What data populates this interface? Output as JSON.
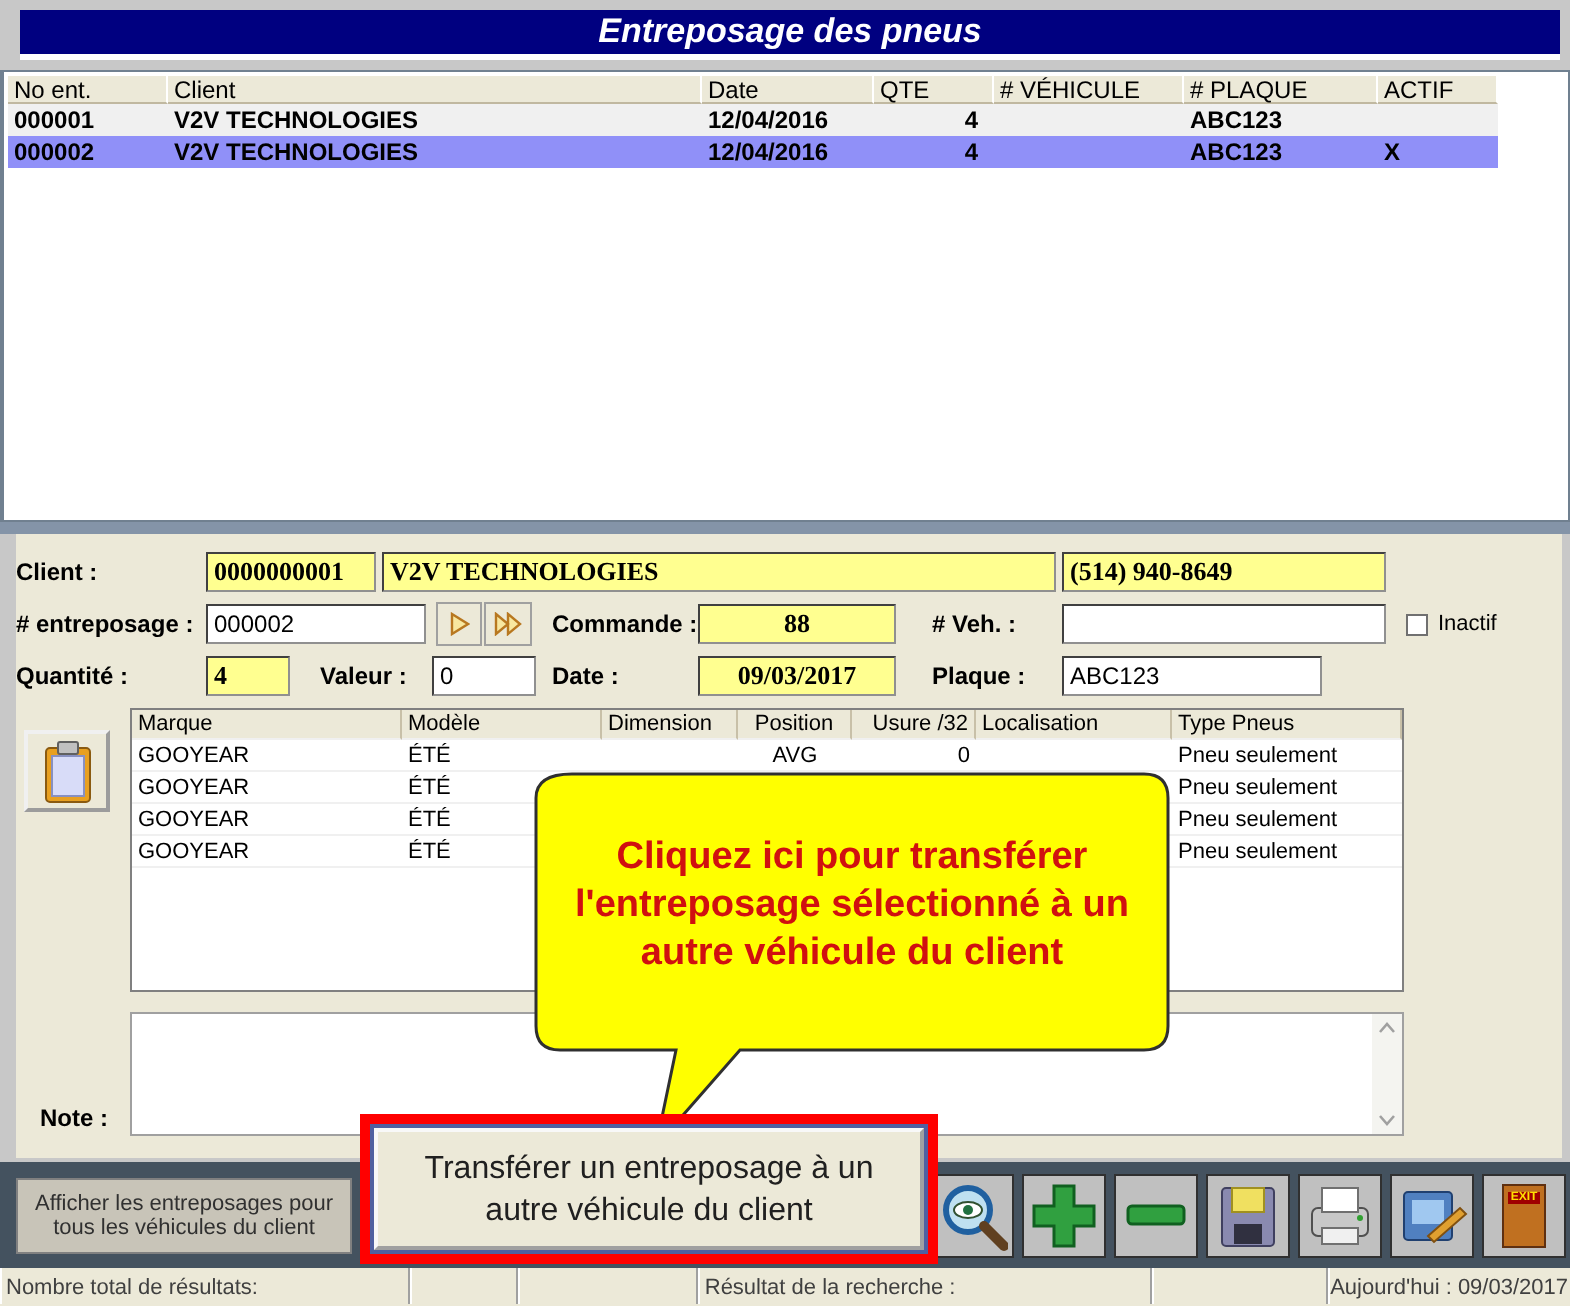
{
  "title": "Entreposage des pneus",
  "storage_list": {
    "columns": [
      "No ent.",
      "Client",
      "Date",
      "QTE",
      "# VÉHICULE",
      "# PLAQUE",
      "ACTIF"
    ],
    "rows": [
      {
        "cells": [
          "000001",
          "V2V TECHNOLOGIES",
          "12/04/2016",
          "4",
          "",
          "ABC123",
          ""
        ],
        "selected": false
      },
      {
        "cells": [
          "000002",
          "V2V TECHNOLOGIES",
          "12/04/2016",
          "4",
          "",
          "ABC123",
          "X"
        ],
        "selected": true
      }
    ]
  },
  "form": {
    "client": {
      "label": "Client :",
      "number": "0000000001",
      "name": "V2V TECHNOLOGIES",
      "phone": "(514) 940-8649",
      "readonly": true
    },
    "storage": {
      "label": "# entreposage :",
      "value": "000002",
      "readonly": false
    },
    "order": {
      "label": "Commande :",
      "value": "88",
      "readonly": true
    },
    "vehicle": {
      "label": "# Veh. :",
      "readonly": false
    },
    "inactive": {
      "label": "Inactif",
      "checked": false
    },
    "quantity": {
      "label": "Quantité :",
      "value": "4",
      "readonly": true
    },
    "amount": {
      "label": "Valeur :",
      "value": "0",
      "readonly": false
    },
    "date": {
      "label": "Date :",
      "value": "09/03/2017",
      "readonly": true
    },
    "plate": {
      "label": "Plaque :",
      "value": "ABC123",
      "readonly": false
    }
  },
  "tires": {
    "columns": [
      "Marque",
      "Modèle",
      "Dimension",
      "Position",
      "Usure /32",
      "Localisation",
      "Type Pneus"
    ],
    "rows": [
      {
        "marque": "GOOYEAR",
        "modele": "ÉTÉ",
        "position": "AVG",
        "usure": "0",
        "type": "Pneu seulement"
      },
      {
        "marque": "GOOYEAR",
        "modele": "ÉTÉ",
        "type": "Pneu seulement"
      },
      {
        "marque": "GOOYEAR",
        "modele": "ÉTÉ",
        "type": "Pneu seulement"
      },
      {
        "marque": "GOOYEAR",
        "modele": "ÉTÉ",
        "type": "Pneu seulement"
      }
    ]
  },
  "note": {
    "label": "Note :"
  },
  "toolbar": [
    {
      "kind": "text",
      "label": "Afficher les entreposages pour tous les véhicules du client"
    },
    {
      "kind": "search"
    },
    {
      "kind": "add"
    },
    {
      "kind": "remove"
    },
    {
      "kind": "save"
    },
    {
      "kind": "print"
    },
    {
      "kind": "tools"
    },
    {
      "kind": "exit",
      "label": "EXIT"
    }
  ],
  "status_bar": {
    "results_label": "Nombre total de résultats:",
    "search_label": "Résultat de la recherche :",
    "today": "Aujourd'hui : 09/03/2017"
  },
  "callout": {
    "text": "Cliquez ici pour transférer l'entreposage sélectionné à un autre véhicule du client",
    "button": "Transférer un entreposage à un autre véhicule du client"
  }
}
